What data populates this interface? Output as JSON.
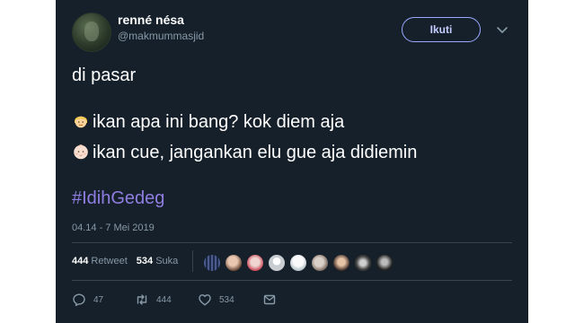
{
  "tweet": {
    "display_name": "renné nésa",
    "username": "@makmummasjid",
    "follow_label": "Ikuti",
    "text": {
      "line1": "di pasar",
      "line2": "ikan apa ini bang? kok diem aja",
      "line3": "ikan cue, jangankan elu gue aja didiemin",
      "hashtag": "#IdihGedeg"
    },
    "timestamp": "04.14 - 7 Mei 2019",
    "stats": {
      "retweets_count": "444",
      "retweets_label": "Retweet",
      "likes_count": "534",
      "likes_label": "Suka"
    },
    "actions": {
      "reply_count": "47",
      "retweet_count": "444",
      "like_count": "534"
    }
  },
  "colors": {
    "background": "#15202b",
    "text_primary": "#ffffff",
    "text_secondary": "#8899a6",
    "hashtag": "#8f7ee0",
    "follow_border": "#9aa9ff"
  },
  "icons": {
    "emoji_line2": "blond-person-emoji",
    "emoji_line3": "baby-emoji",
    "reply": "reply-icon",
    "retweet": "retweet-icon",
    "like": "heart-icon",
    "dm": "envelope-icon",
    "menu": "chevron-down-icon"
  }
}
